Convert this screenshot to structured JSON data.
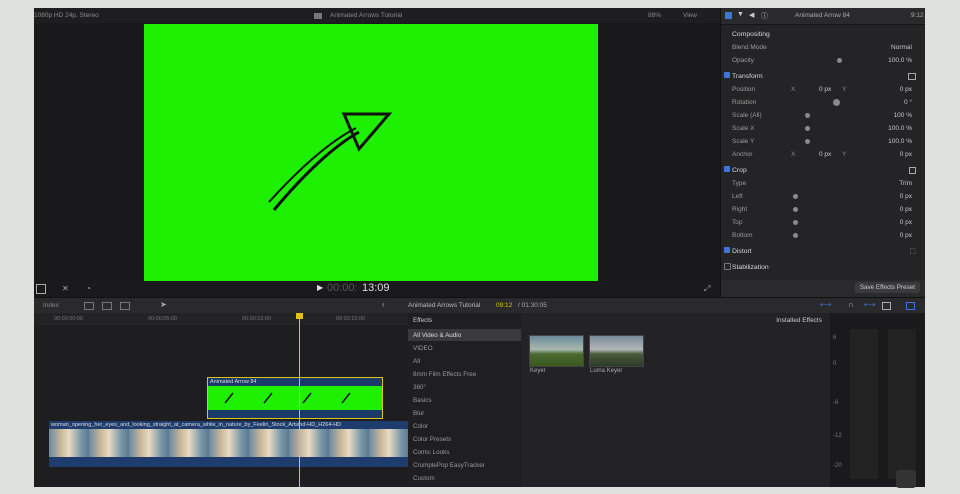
{
  "viewer": {
    "format": "1080p HD 24p, Stereo",
    "title": "Animated Arrows Tutorial",
    "zoom": "88%",
    "view_label": "View",
    "timecode": "13:09",
    "timecode_prefix": "00:00:"
  },
  "inspector": {
    "clip_name": "Animated Arrow 84",
    "time": "9:12",
    "compositing": {
      "label": "Compositing",
      "blend_mode_label": "Blend Mode",
      "blend_mode_value": "Normal",
      "opacity_label": "Opacity",
      "opacity_value": "100.0 %"
    },
    "transform": {
      "label": "Transform",
      "position_label": "Position",
      "x_label": "X",
      "y_label": "Y",
      "position_x": "0 px",
      "position_y": "0 px",
      "rotation_label": "Rotation",
      "rotation_value": "0 °",
      "scale_all_label": "Scale (All)",
      "scale_all_value": "100 %",
      "scale_x_label": "Scale X",
      "scale_x_value": "100.0 %",
      "scale_y_label": "Scale Y",
      "scale_y_value": "100.0 %",
      "anchor_label": "Anchor",
      "anchor_x": "0 px",
      "anchor_y": "0 px"
    },
    "crop": {
      "label": "Crop",
      "type_label": "Type",
      "type_value": "Trim",
      "left_label": "Left",
      "left_value": "0 px",
      "right_label": "Right",
      "right_value": "0 px",
      "top_label": "Top",
      "top_value": "0 px",
      "bottom_label": "Bottom",
      "bottom_value": "0 px"
    },
    "distort_label": "Distort",
    "stabilization_label": "Stabilization",
    "save_preset": "Save Effects Preset"
  },
  "timeline_bar": {
    "index": "Index",
    "project": "Animated Arrows Tutorial",
    "position": "09:12",
    "duration": "/ 01:30:05"
  },
  "ruler": [
    "00:00:00:00",
    "00:00:05:00",
    "00:00:10:00",
    "00:00:15:00"
  ],
  "clips": {
    "title_clip": "Animated Arrow 84",
    "video_clip": "woman_opening_her_eyes_and_looking_straight_at_camera_while_in_nature_by_Feelin_Stock_Artsind-HD_H264-HD"
  },
  "effects": {
    "header": "Effects",
    "installed": "Installed Effects",
    "categories": [
      "All Video & Audio",
      "VIDEO",
      "All",
      "8mm Film Effects Free",
      "360°",
      "Basics",
      "Blur",
      "Color",
      "Color Presets",
      "Comic Looks",
      "CrumplePop EasyTracker",
      "Custom"
    ],
    "selected_index": 0,
    "items": [
      {
        "name": "Keyer"
      },
      {
        "name": "Luma Keyer"
      }
    ]
  },
  "meter_labels": [
    "6",
    "0",
    "-6",
    "-12",
    "-20"
  ],
  "colors": {
    "chroma_green": "#1df000",
    "playhead": "#e0c21a",
    "accent_blue": "#3f74d8"
  }
}
